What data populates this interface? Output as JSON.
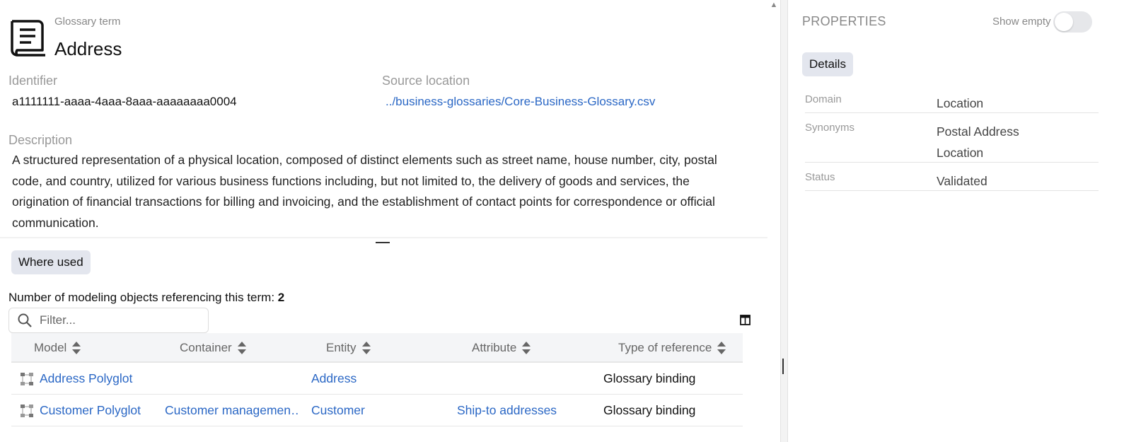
{
  "header": {
    "subtitle": "Glossary term",
    "title": "Address",
    "icon": "glossary-book-icon"
  },
  "fields": {
    "identifier_label": "Identifier",
    "identifier_value": "a1111111-aaaa-4aaa-8aaa-aaaaaaaa0004",
    "source_label": "Source location",
    "source_value": "../business-glossaries/Core-Business-Glossary.csv",
    "description_label": "Description",
    "description_value": "A structured representation of a physical location, composed of distinct elements such as street name, house number, city, postal code, and country, utilized for various business functions including, but not limited to, the delivery of goods and services, the origination of financial transactions for billing and invoicing, and the establishment of contact points for correspondence or official communication."
  },
  "where_used": {
    "tab_label": "Where used",
    "count_prefix": "Number of modeling objects referencing this term: ",
    "count_value": "2",
    "filter_placeholder": "Filter...",
    "columns": [
      "Model",
      "Container",
      "Entity",
      "Attribute",
      "Type of reference"
    ],
    "rows": [
      {
        "model": "Address Polyglot",
        "container": "",
        "entity": "Address",
        "attribute": "",
        "type": "Glossary binding"
      },
      {
        "model": "Customer Polyglot",
        "container": "Customer managemen…",
        "entity": "Customer",
        "attribute": "Ship-to addresses",
        "type": "Glossary binding"
      }
    ]
  },
  "properties": {
    "title": "PROPERTIES",
    "show_empty_label": "Show empty",
    "show_empty_on": false,
    "details_tab": "Details",
    "domain_label": "Domain",
    "domain_value": "Location",
    "synonyms_label": "Synonyms",
    "synonyms": [
      "Postal Address",
      "Location"
    ],
    "status_label": "Status",
    "status_value": "Validated"
  },
  "colors": {
    "link": "#2a67c5",
    "chip_bg": "#e3e6ee",
    "muted_text": "#999999"
  }
}
